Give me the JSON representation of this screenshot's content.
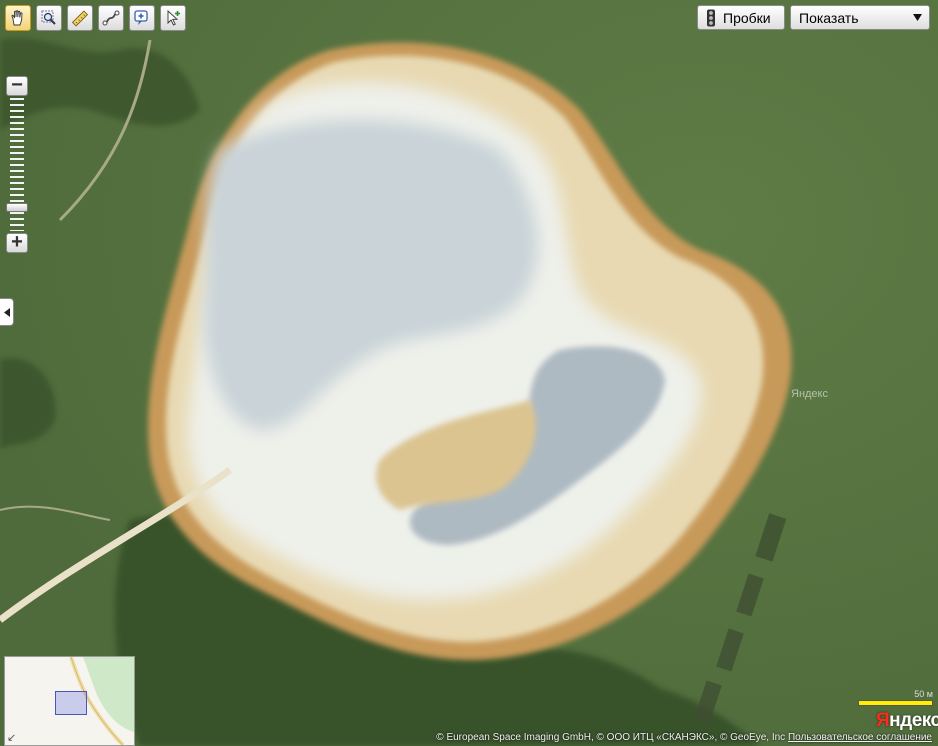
{
  "toolbar": {
    "tools": [
      {
        "name": "hand-tool-button",
        "icon": "hand-icon",
        "active": true
      },
      {
        "name": "magnifier-tool-button",
        "icon": "magnifier-icon",
        "active": false
      },
      {
        "name": "ruler-tool-button",
        "icon": "ruler-icon",
        "active": false
      },
      {
        "name": "route-tool-button",
        "icon": "route-icon",
        "active": false
      },
      {
        "name": "add-placemark-button",
        "icon": "placemark-plus-icon",
        "active": false
      },
      {
        "name": "select-tool-button",
        "icon": "cursor-plus-icon",
        "active": false
      }
    ]
  },
  "traffic": {
    "label": "Пробки",
    "icon": "traffic-light-icon"
  },
  "layers": {
    "selected": "Показать",
    "icon": "triangle-down-icon"
  },
  "zoom": {
    "plus_label": "+",
    "minus_label": "−",
    "level_fraction": 0.15
  },
  "minimap": {
    "corner_icon": "arrow-diagonal-icon",
    "corner_glyph": "↙"
  },
  "scale": {
    "label": "50 м"
  },
  "logo": {
    "first": "Я",
    "rest": "ндекс"
  },
  "watermark": "Яндекс",
  "copyright": {
    "text": "© European Space Imaging GmbH, © ООО ИТЦ «СКАНЭКС», © GeoEye, Inc ",
    "link": "Пользовательское соглашение"
  },
  "colors": {
    "scale_bar": "#ffee00",
    "logo_red": "#ff2a1a",
    "active_tool": "#f3d377"
  }
}
